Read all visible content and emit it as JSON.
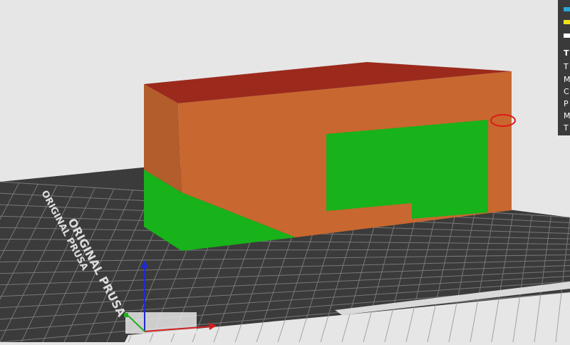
{
  "viewport": {
    "background": "#e6e6e6",
    "bed_color": "#3b3b3b",
    "grid_color": "#8c8c8c",
    "bed_logo_text": "ORIGINAL PRUSA",
    "bed_logo_text_2": "ORIGINAL PRUSA",
    "model_colors": {
      "top_layer": "#9b2a1c",
      "walls": "#c8672f",
      "walls_shade": "#a9582a",
      "support_green": "#18b21a"
    },
    "axis_colors": {
      "x": "#d02020",
      "y": "#20b020",
      "z": "#1d2bd0"
    },
    "highlight_marker": "red-ellipse"
  },
  "legend": {
    "items": [
      {
        "color": "#2aa7d6",
        "label": ""
      },
      {
        "color": "#f0e01a",
        "label": ""
      },
      {
        "color": "#ffffff",
        "label": ""
      }
    ],
    "rows": [
      "T",
      "T",
      "M",
      "C",
      "P",
      "M",
      "T"
    ]
  }
}
